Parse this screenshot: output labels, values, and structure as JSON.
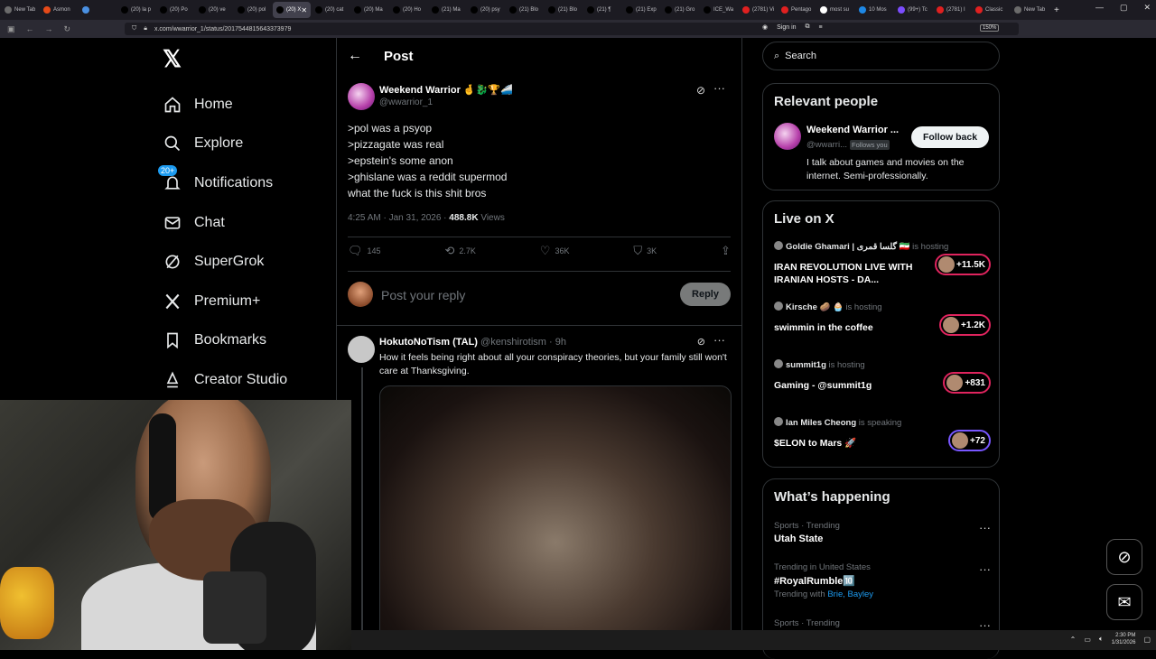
{
  "browser": {
    "tabs": [
      {
        "label": "New Tab",
        "color": "#6b6b6b"
      },
      {
        "label": "Asmon",
        "color": "#e64a19"
      },
      {
        "label": "",
        "color": "#4a90e2"
      },
      {
        "label": "(20) la p",
        "color": "#000000"
      },
      {
        "label": "(20) Po",
        "color": "#000000"
      },
      {
        "label": "(20) ve",
        "color": "#000000"
      },
      {
        "label": "(20) pol",
        "color": "#000000"
      },
      {
        "label": "(20) X",
        "color": "#000000",
        "active": true
      },
      {
        "label": "(20) cat",
        "color": "#000000"
      },
      {
        "label": "(20) Ma",
        "color": "#000000"
      },
      {
        "label": "(20) Ho",
        "color": "#000000"
      },
      {
        "label": "(21) Ma",
        "color": "#000000"
      },
      {
        "label": "(20) psy",
        "color": "#000000"
      },
      {
        "label": "(21) Blo",
        "color": "#000000"
      },
      {
        "label": "(21) Blo",
        "color": "#000000"
      },
      {
        "label": "(21) ¶",
        "color": "#000000"
      },
      {
        "label": "(21) Exp",
        "color": "#000000"
      },
      {
        "label": "(21) Gro",
        "color": "#000000"
      },
      {
        "label": "ICE_Wa",
        "color": "#000000"
      },
      {
        "label": "(2781) Vi",
        "color": "#e02020"
      },
      {
        "label": "Pentago",
        "color": "#e02020"
      },
      {
        "label": "most su",
        "color": "#ffffff"
      },
      {
        "label": "10 Mos",
        "color": "#1e88e5"
      },
      {
        "label": "(99+) Tc",
        "color": "#7c4dff"
      },
      {
        "label": "(2781) I",
        "color": "#e02020"
      },
      {
        "label": "Classic",
        "color": "#e02020"
      },
      {
        "label": "New Tab",
        "color": "#6b6b6b"
      }
    ],
    "url": "x.com/wwarrior_1/status/2017544815643373979",
    "zoom": "150%",
    "sign_in": "Sign in"
  },
  "sidebar": {
    "logo": "𝕏",
    "items": [
      {
        "label": "Home",
        "icon": "home-icon"
      },
      {
        "label": "Explore",
        "icon": "search-icon"
      },
      {
        "label": "Notifications",
        "icon": "bell-icon",
        "badge": "20+"
      },
      {
        "label": "Chat",
        "icon": "mail-icon"
      },
      {
        "label": "SuperGrok",
        "icon": "grok-icon"
      },
      {
        "label": "Premium+",
        "icon": "x-logo-icon"
      },
      {
        "label": "Bookmarks",
        "icon": "bookmark-icon"
      },
      {
        "label": "Creator Studio",
        "icon": "creator-icon"
      }
    ]
  },
  "post": {
    "header": "Post",
    "author_name": "Weekend Warrior 🤞🐉🏆🚄",
    "author_handle": "@wwarrior_1",
    "lines": [
      ">pol was a psyop",
      ">pizzagate was real",
      ">epstein's some anon",
      ">ghislane was a reddit supermod",
      "what the fuck is this shit bros"
    ],
    "time": "4:25 AM · Jan 31, 2026 · ",
    "views_count": "488.8K",
    "views_label": " Views",
    "replies": "145",
    "reposts": "2.7K",
    "likes": "36K",
    "bookmarks": "3K",
    "reply_placeholder": "Post your reply",
    "reply_button": "Reply"
  },
  "reply": {
    "name": "HokutoNoTism (TAL)",
    "handle_time": " @kenshirotism · 9h",
    "text": "How it feels being right about all your conspiracy theories, but your family still won't care at Thanksgiving."
  },
  "right": {
    "search_placeholder": "Search",
    "relevant": {
      "title": "Relevant people",
      "name": "Weekend Warrior ...",
      "handle": "@wwarri...",
      "follows_you": "Follows you",
      "follow_button": "Follow back",
      "bio": "I talk about games and movies on the internet. Semi-professionally."
    },
    "live": {
      "title": "Live on X",
      "items": [
        {
          "host": "Goldie Ghamari | گلسا قمری 🇮🇷",
          "status": " is hosting",
          "title": "IRAN REVOLUTION LIVE WITH IRANIAN HOSTS - DA...",
          "count": "+11.5K"
        },
        {
          "host": "Kirsche 🥔 🧁",
          "status": " is hosting",
          "title": "swimmin in the coffee",
          "count": "+1.2K"
        },
        {
          "host": "summit1g",
          "status": " is hosting",
          "title": "Gaming - @summit1g",
          "count": "+831"
        },
        {
          "host": "Ian Miles Cheong",
          "status": " is speaking",
          "title": "$ELON to Mars 🚀",
          "count": "+72"
        }
      ]
    },
    "happening": {
      "title": "What’s happening",
      "trends": [
        {
          "category": "Sports · Trending",
          "name": "Utah State",
          "with": ""
        },
        {
          "category": "Trending in United States",
          "name": "#RoyalRumble🔟",
          "with_label": "Trending with ",
          "with": "Brie, Bayley"
        },
        {
          "category": "Sports · Trending",
          "name": "",
          "with": ""
        }
      ]
    }
  },
  "taskbar": {
    "time": "2:30 PM",
    "date": "1/31/2026"
  }
}
